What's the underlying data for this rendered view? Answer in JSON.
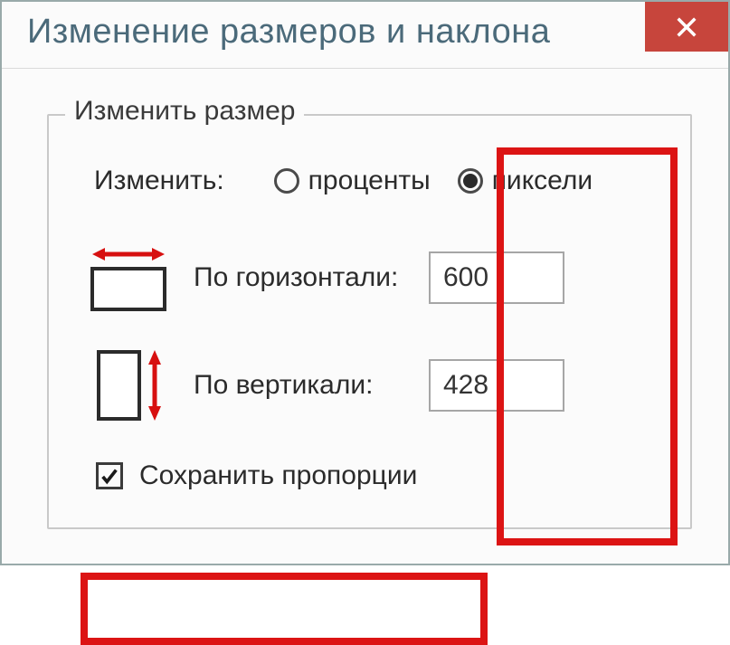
{
  "window": {
    "title": "Изменение размеров и наклона"
  },
  "group": {
    "label": "Изменить размер",
    "change_label": "Изменить:",
    "radio_percent": "проценты",
    "radio_pixels": "пиксели",
    "horizontal_label": "По горизонтали:",
    "vertical_label": "По вертикали:",
    "horizontal_value": "600",
    "vertical_value": "428",
    "keep_aspect": "Сохранить пропорции"
  },
  "state": {
    "unit_selected": "pixels",
    "keep_aspect_checked": true
  }
}
